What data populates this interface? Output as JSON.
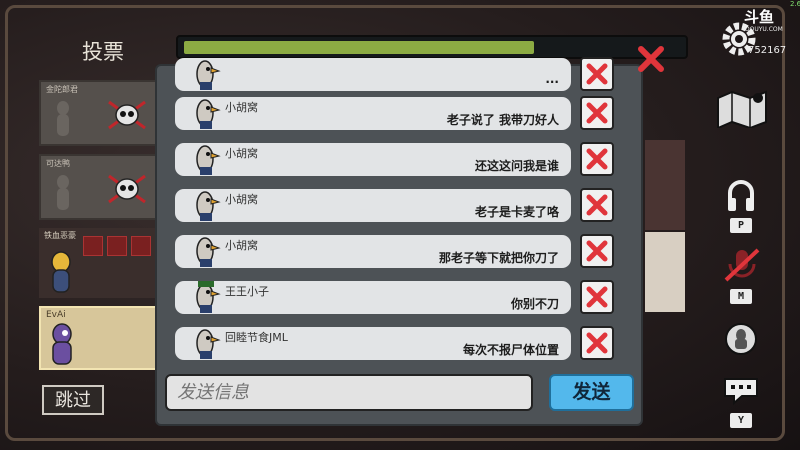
{
  "header": {
    "vote_title": "投票"
  },
  "progress": {
    "value": 0.7
  },
  "players": [
    {
      "name": "金陀郎君"
    },
    {
      "name": "可达鸭"
    },
    {
      "name": "铁血恶豪"
    },
    {
      "name": "EvAi"
    }
  ],
  "chat": {
    "messages": [
      {
        "sender": "",
        "text": "..."
      },
      {
        "sender": "小胡窝",
        "text": "老子说了 我带刀好人"
      },
      {
        "sender": "小胡窝",
        "text": "还这这问我是谁"
      },
      {
        "sender": "小胡窝",
        "text": "老子是卡麦了咯"
      },
      {
        "sender": "小胡窝",
        "text": "那老子等下就把你刀了"
      },
      {
        "sender": "王王小子",
        "text": "你别不刀"
      },
      {
        "sender": "回睦节食JML",
        "text": "每次不报尸体位置"
      }
    ],
    "input_placeholder": "发送信息",
    "send_label": "发送"
  },
  "skip_label": "跳过",
  "hotkeys": {
    "voice": "P",
    "mute": "M",
    "chat": "Y"
  },
  "stream": {
    "logo": "斗鱼",
    "logo_sub": "DOUYU.COM",
    "viewers": "752167",
    "fps": "2.6"
  },
  "colors": {
    "accent_red": "#e0353b",
    "send_blue": "#53b8ec",
    "progress_green": "#8cab43"
  }
}
